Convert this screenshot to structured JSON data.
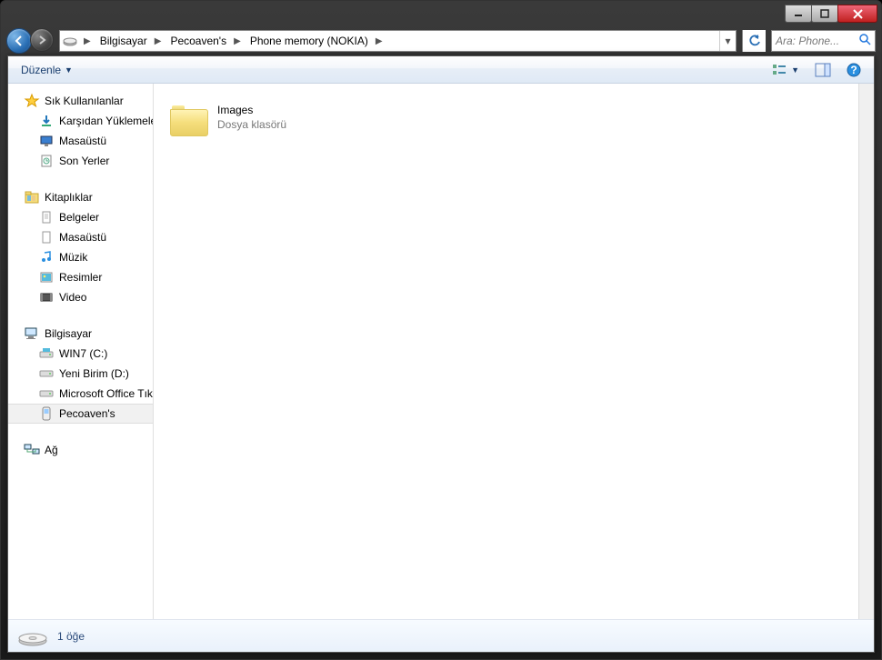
{
  "breadcrumbs": [
    "Bilgisayar",
    "Pecoaven's",
    "Phone memory (NOKIA)"
  ],
  "search": {
    "placeholder": "Ara: Phone..."
  },
  "toolbar": {
    "organize": "Düzenle"
  },
  "sidebar": {
    "favorites": {
      "label": "Sık Kullanılanlar",
      "items": [
        "Karşıdan Yüklemeler",
        "Masaüstü",
        "Son Yerler"
      ]
    },
    "libraries": {
      "label": "Kitaplıklar",
      "items": [
        "Belgeler",
        "Masaüstü",
        "Müzik",
        "Resimler",
        "Video"
      ]
    },
    "computer": {
      "label": "Bilgisayar",
      "items": [
        "WIN7 (C:)",
        "Yeni Birim (D:)",
        "Microsoft Office Tıkla",
        "Pecoaven's"
      ],
      "selected_index": 3
    },
    "network": {
      "label": "Ağ"
    }
  },
  "content": {
    "items": [
      {
        "name": "Images",
        "subtitle": "Dosya klasörü"
      }
    ]
  },
  "status": {
    "text": "1 öğe"
  }
}
